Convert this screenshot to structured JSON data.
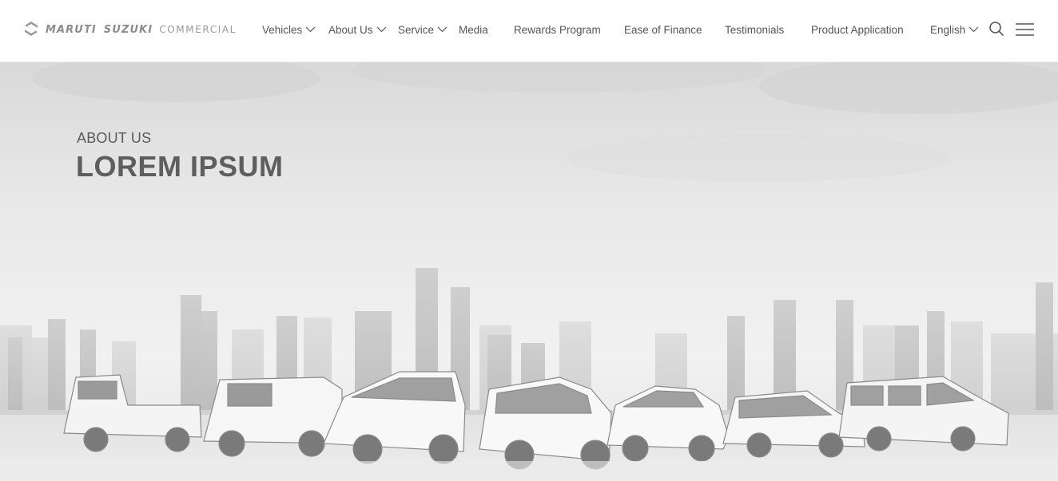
{
  "brand": {
    "word1": "MARUTI",
    "word2": "SUZUKI",
    "sub": "COMMERCIAL"
  },
  "nav": {
    "items": [
      {
        "label": "Vehicles",
        "has_dropdown": true
      },
      {
        "label": "About Us",
        "has_dropdown": true
      },
      {
        "label": "Service",
        "has_dropdown": true
      },
      {
        "label": "Media",
        "has_dropdown": false
      },
      {
        "label": "Rewards Program",
        "has_dropdown": false
      },
      {
        "label": "Ease of Finance",
        "has_dropdown": false
      },
      {
        "label": "Testimonials",
        "has_dropdown": false
      },
      {
        "label": "Product Application",
        "has_dropdown": false
      }
    ],
    "language": {
      "label": "English",
      "has_dropdown": true
    }
  },
  "icons": {
    "search": "search-icon",
    "menu": "hamburger-menu-icon",
    "logo": "suzuki-logo-icon",
    "chevron": "chevron-down-icon"
  },
  "hero": {
    "eyebrow": "ABOUT US",
    "title": "LOREM IPSUM"
  },
  "colors": {
    "header_bg": "#ffffff",
    "nav_text": "#555555",
    "hero_text": "#5e5e5e"
  }
}
